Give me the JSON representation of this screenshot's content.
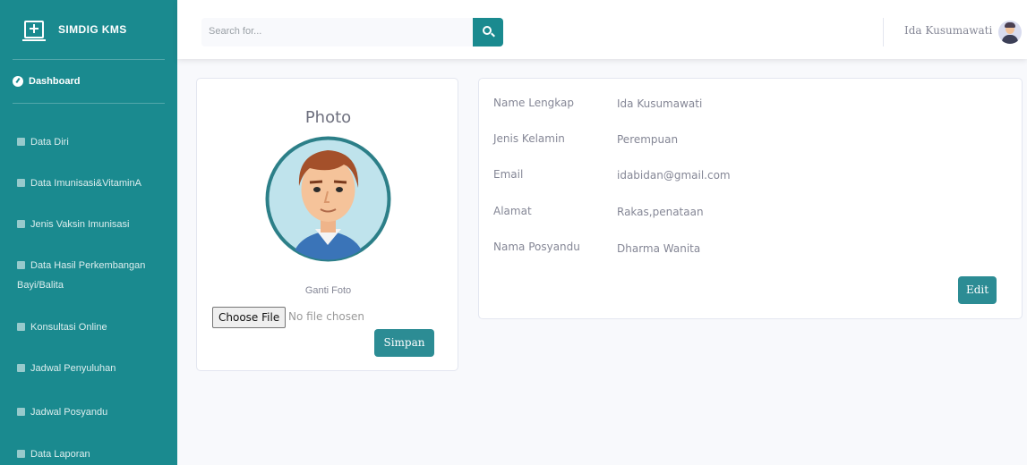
{
  "brand": {
    "name": "SIMDIG KMS",
    "icon": "monitor-plus-icon"
  },
  "sidebar": {
    "dashboard": "Dashboard",
    "items": [
      {
        "label": "Data Diri",
        "icon": "user-icon"
      },
      {
        "label": "Data Imunisasi&VitaminA",
        "icon": "table-icon"
      },
      {
        "label": "Jenis Vaksin Imunisasi",
        "icon": "list-icon"
      },
      {
        "label": "Data Hasil Perkembangan",
        "label2": "Bayi/Balita",
        "icon": "child-icon"
      },
      {
        "label": "Konsultasi Online",
        "icon": "chat-icon"
      },
      {
        "label": "Jadwal Penyuluhan",
        "icon": "calendar-icon"
      },
      {
        "label": "Jadwal Posyandu",
        "icon": "calendar-icon"
      },
      {
        "label": "Data Laporan",
        "icon": "report-icon"
      }
    ]
  },
  "topbar": {
    "search_placeholder": "Search for...",
    "user_name": "Ida Kusumawati"
  },
  "photo_card": {
    "title": "Photo",
    "ganti_label": "Ganti Foto",
    "choose_file": "Choose File",
    "no_file": "No file chosen",
    "save_label": "Simpan"
  },
  "profile": {
    "fields": [
      {
        "label": "Name Lengkap",
        "value": "Ida Kusumawati"
      },
      {
        "label": "Jenis Kelamin",
        "value": "Perempuan"
      },
      {
        "label": "Email",
        "value": "idabidan@gmail.com"
      },
      {
        "label": "Alamat",
        "value": "Rakas,penataan"
      },
      {
        "label": "Nama Posyandu",
        "value": "Dharma Wanita"
      }
    ],
    "edit_label": "Edit"
  },
  "colors": {
    "primary": "#1a8a8f",
    "button": "#2c8c94",
    "background": "#f8f9fc"
  }
}
